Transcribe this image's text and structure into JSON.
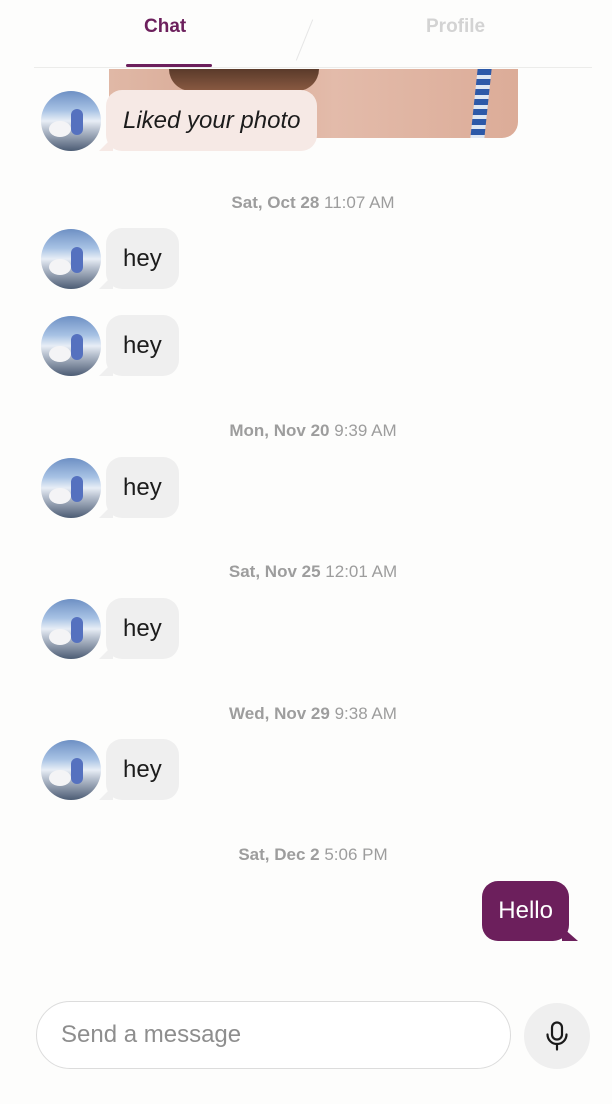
{
  "tabs": {
    "chat": "Chat",
    "profile": "Profile"
  },
  "colors": {
    "accent": "#6c1f5c",
    "bubble_in": "#efefef",
    "bubble_like": "#f6e9e5"
  },
  "messages": [
    {
      "type": "received",
      "text": "Liked your photo"
    },
    {
      "type": "timestamp",
      "day": "Sat, Oct 28",
      "time": "11:07 AM"
    },
    {
      "type": "received",
      "text": "hey"
    },
    {
      "type": "received",
      "text": "hey"
    },
    {
      "type": "timestamp",
      "day": "Mon, Nov 20",
      "time": "9:39 AM"
    },
    {
      "type": "received",
      "text": "hey"
    },
    {
      "type": "timestamp",
      "day": "Sat, Nov 25",
      "time": "12:01 AM"
    },
    {
      "type": "received",
      "text": "hey"
    },
    {
      "type": "timestamp",
      "day": "Wed, Nov 29",
      "time": "9:38 AM"
    },
    {
      "type": "received",
      "text": "hey"
    },
    {
      "type": "timestamp",
      "day": "Sat, Dec 2",
      "time": "5:06 PM"
    },
    {
      "type": "sent",
      "text": "Hello"
    }
  ],
  "composer": {
    "placeholder": "Send a message",
    "value": ""
  },
  "icons": {
    "mic": "microphone-icon"
  }
}
